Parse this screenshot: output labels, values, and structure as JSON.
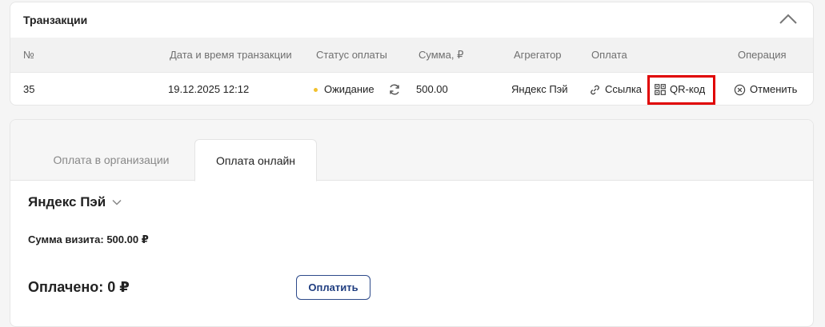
{
  "transactions": {
    "title": "Транзакции",
    "columns": {
      "num": "№",
      "datetime": "Дата и время транзакции",
      "status": "Статус оплаты",
      "amount": "Сумма, ₽",
      "aggregator": "Агрегатор",
      "payment": "Оплата",
      "operation": "Операция"
    },
    "rows": [
      {
        "num": "35",
        "datetime": "19.12.2025 12:12",
        "status": "Ожидание",
        "status_color": "#f2c12e",
        "amount": "500.00",
        "aggregator": "Яндекс Пэй",
        "link_label": "Ссылка",
        "qr_label": "QR-код",
        "cancel_label": "Отменить"
      }
    ]
  },
  "payment_panel": {
    "tabs": [
      {
        "label": "Оплата в организации",
        "active": false
      },
      {
        "label": "Оплата онлайн",
        "active": true
      }
    ],
    "aggregator_selected": "Яндекс Пэй",
    "visit_sum": "Сумма визита: 500.00 ₽",
    "paid": "Оплачено: 0 ₽",
    "pay_button": "Оплатить"
  },
  "colors": {
    "highlight": "#e00000",
    "pay_button": "#1f3d80"
  }
}
